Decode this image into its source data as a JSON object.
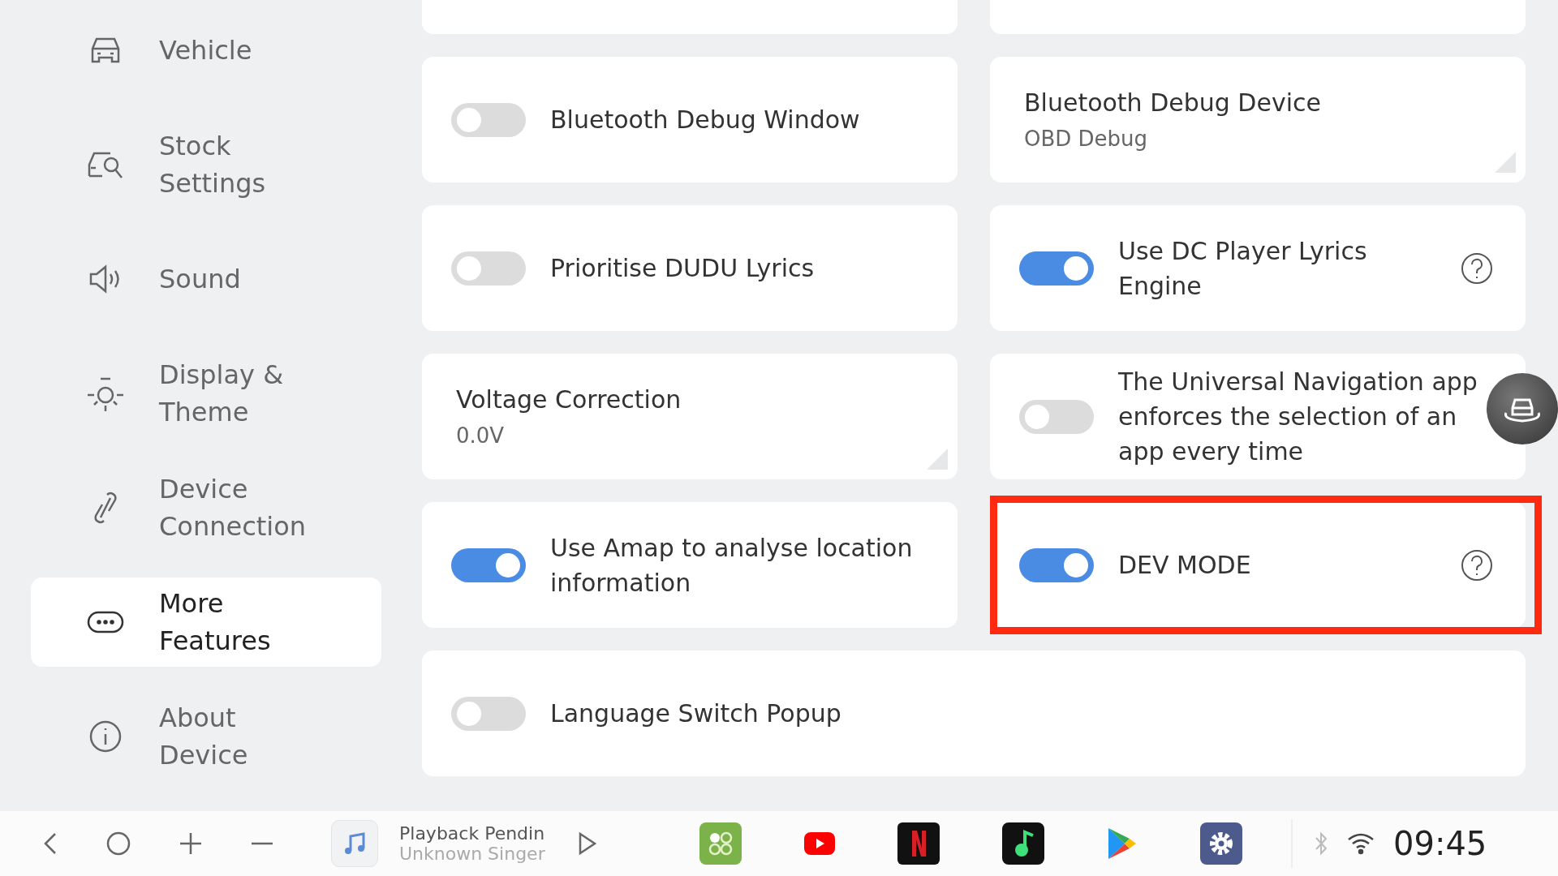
{
  "sidebar": {
    "items": [
      {
        "label": "Vehicle",
        "selected": false
      },
      {
        "label": "Stock Settings",
        "selected": false
      },
      {
        "label": "Sound",
        "selected": false
      },
      {
        "label": "Display & Theme",
        "selected": false
      },
      {
        "label": "Device Connection",
        "selected": false
      },
      {
        "label": "More Features",
        "selected": true
      },
      {
        "label": "About Device",
        "selected": false
      }
    ]
  },
  "settings": [
    {
      "kind": "toggle",
      "label": "Bluetooth Debug Window",
      "on": false,
      "help": false,
      "highlighted": false
    },
    {
      "kind": "value",
      "label": "Bluetooth Debug Device",
      "value": "OBD Debug",
      "highlighted": false
    },
    {
      "kind": "toggle",
      "label": "Prioritise DUDU Lyrics",
      "on": false,
      "help": false,
      "highlighted": false
    },
    {
      "kind": "toggle",
      "label": "Use DC Player Lyrics Engine",
      "on": true,
      "help": true,
      "highlighted": false
    },
    {
      "kind": "value",
      "label": "Voltage Correction",
      "value": "0.0V",
      "highlighted": false
    },
    {
      "kind": "toggle",
      "label": "The Universal Navigation app enforces the selection of an app every time",
      "on": false,
      "help": false,
      "highlighted": false
    },
    {
      "kind": "toggle",
      "label": "Use Amap to analyse location information",
      "on": true,
      "help": false,
      "highlighted": false
    },
    {
      "kind": "toggle",
      "label": "DEV MODE",
      "on": true,
      "help": true,
      "highlighted": true
    },
    {
      "kind": "wide_toggle",
      "label": "Language Switch Popup",
      "on": false,
      "help": false,
      "highlighted": false
    }
  ],
  "media": {
    "title": "Playback Pendin",
    "artist": "Unknown Singer"
  },
  "status_bar": {
    "time": "09:45"
  }
}
